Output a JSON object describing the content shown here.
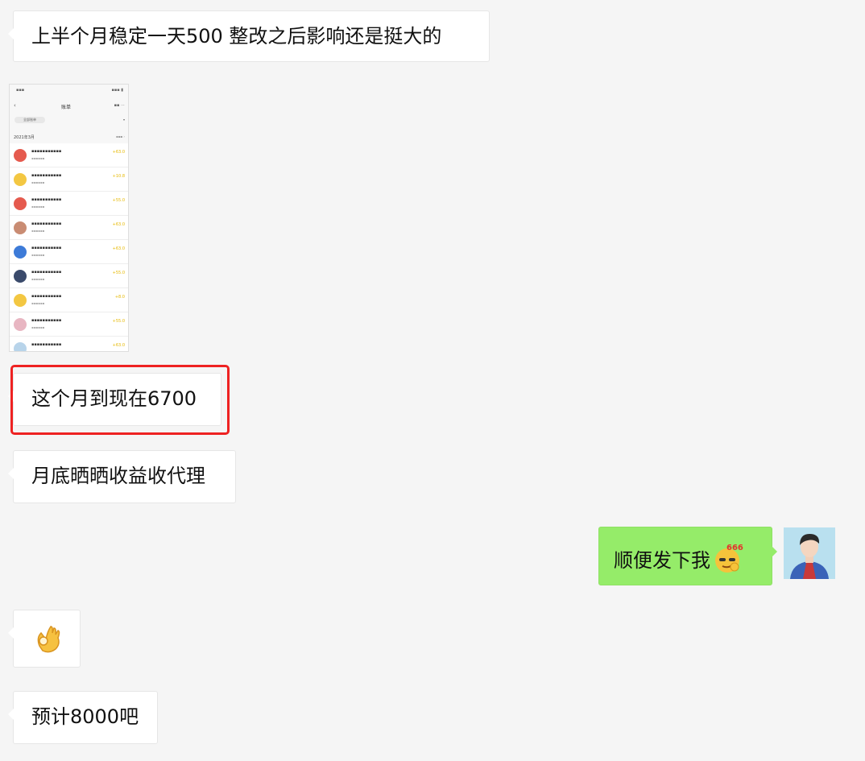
{
  "messages": [
    {
      "side": "left",
      "type": "text",
      "text": "上半个月稳定一天500 整改之后影响还是挺大的"
    },
    {
      "side": "left",
      "type": "image",
      "image": {
        "nav_title": "账单",
        "filter": "全部账单",
        "month": "2021年3月",
        "rows": [
          {
            "icon_color": "#e55a4e",
            "amount": "+63.0"
          },
          {
            "icon_color": "#f3c742",
            "amount": "+10.8"
          },
          {
            "icon_color": "#e55a4e",
            "amount": "+55.0"
          },
          {
            "icon_color": "#c98c73",
            "amount": "+63.0"
          },
          {
            "icon_color": "#3d7bd8",
            "amount": "+63.0"
          },
          {
            "icon_color": "#3a4a6b",
            "amount": "+55.0"
          },
          {
            "icon_color": "#f3c742",
            "amount": "+8.0"
          },
          {
            "icon_color": "#e8b6c2",
            "amount": "+55.0"
          },
          {
            "icon_color": "#b8d4ea",
            "amount": "+63.0"
          }
        ]
      }
    },
    {
      "side": "left",
      "type": "text",
      "text": "这个月到现在6700",
      "highlighted": true
    },
    {
      "side": "left",
      "type": "text",
      "text": "月底晒晒收益收代理"
    },
    {
      "side": "right",
      "type": "text",
      "text": "顺便发下我",
      "emoji": "666-emoji"
    },
    {
      "side": "left",
      "type": "emoji",
      "emoji": "ok-hand-emoji",
      "glyph": "👌"
    },
    {
      "side": "left",
      "type": "text",
      "text": "预计8000吧"
    }
  ],
  "colors": {
    "background": "#f5f5f5",
    "left_bubble": "#ffffff",
    "right_bubble": "#95ec69",
    "highlight": "#ee2222"
  }
}
